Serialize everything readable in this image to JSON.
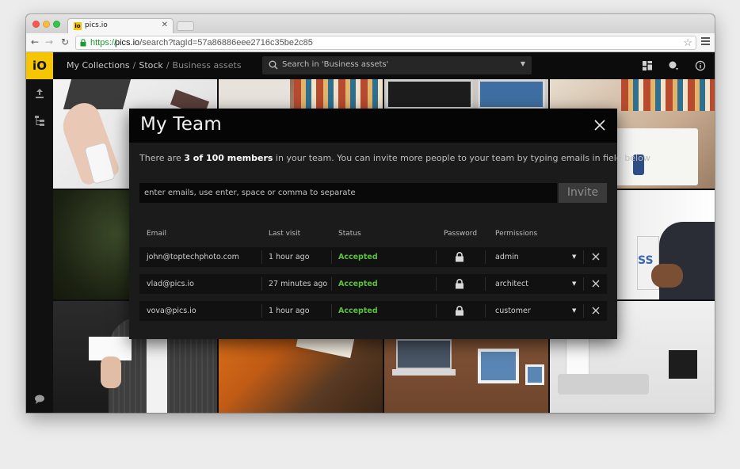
{
  "browser": {
    "tab_title": "pics.io",
    "tab_favicon": "io",
    "url_scheme": "https://",
    "url_host": "pics.io",
    "url_path": "/search?tagId=57a86886eee2716c35be2c85"
  },
  "app": {
    "logo": "iO",
    "breadcrumb": {
      "items": [
        "My Collections",
        "Stock"
      ],
      "current": "Business assets"
    },
    "search": {
      "placeholder": "Search in 'Business assets'"
    },
    "accent_color": "#f5c600"
  },
  "modal": {
    "title": "My Team",
    "intro_before": "There are ",
    "intro_count": "3 of 100 members",
    "intro_after": " in your team. You can invite more people to your team by typing emails in field below",
    "invite_placeholder": "enter emails, use enter, space or comma to separate",
    "invite_button": "Invite",
    "columns": {
      "email": "Email",
      "last_visit": "Last visit",
      "status": "Status",
      "password": "Password",
      "permissions": "Permissions"
    },
    "members": [
      {
        "email": "john@toptechphoto.com",
        "last_visit": "1 hour ago",
        "status": "Accepted",
        "permission": "admin"
      },
      {
        "email": "vlad@pics.io",
        "last_visit": "27 minutes ago",
        "status": "Accepted",
        "permission": "architect"
      },
      {
        "email": "vova@pics.io",
        "last_visit": "1 hour ago",
        "status": "Accepted",
        "permission": "customer"
      }
    ],
    "status_color": "#5ac13a"
  }
}
